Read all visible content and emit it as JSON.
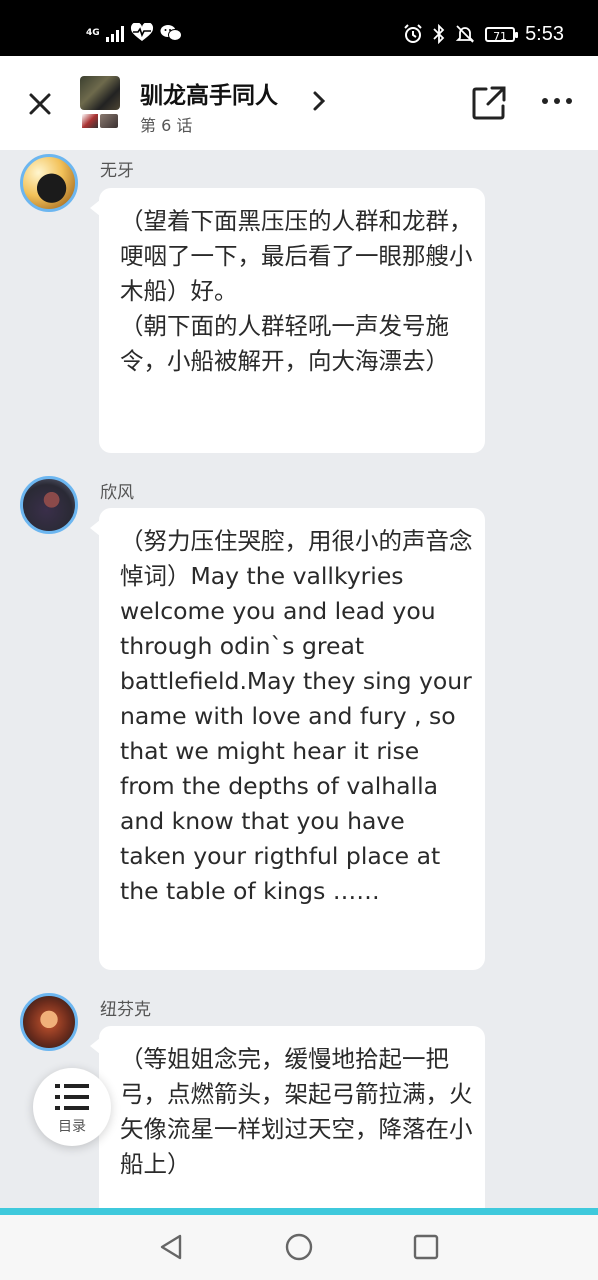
{
  "status_bar": {
    "network": "4G",
    "time": "5:53",
    "battery": "71",
    "icons": [
      "signal-icon",
      "heart-rate-icon",
      "wechat-icon",
      "alarm-icon",
      "bluetooth-icon",
      "mute-icon",
      "battery-icon"
    ]
  },
  "header": {
    "title": "驯龙高手同人",
    "subtitle": "第 6 话",
    "icons": [
      "close-icon",
      "chevron-right-icon",
      "share-icon",
      "more-icon"
    ]
  },
  "messages": [
    {
      "name": "无牙",
      "text": "（望着下面黑压压的人群和龙群，哽咽了一下，最后看了一眼那艘小木船）好。\n（朝下面的人群轻吼一声发号施令，小船被解开，向大海漂去）"
    },
    {
      "name": "欣风",
      "text": "（努力压住哭腔，用很小的声音念悼词）May the vallkyries welcome you and lead you through odin`s great battlefield.May they sing your name with love and fury , so that we might hear it rise from the depths of valhalla and know that you have taken your rigthful place at the table of kings ……"
    },
    {
      "name": "纽芬克",
      "text": "（等姐姐念完，缓慢地拾起一把弓，点燃箭头，架起弓箭拉满，火矢像流星一样划过天空，降落在小船上）"
    }
  ],
  "toc": {
    "label": "目录"
  },
  "colors": {
    "accent": "#3fc9dc",
    "avatar_ring": "#6cb6f0",
    "background": "#eaecef"
  }
}
